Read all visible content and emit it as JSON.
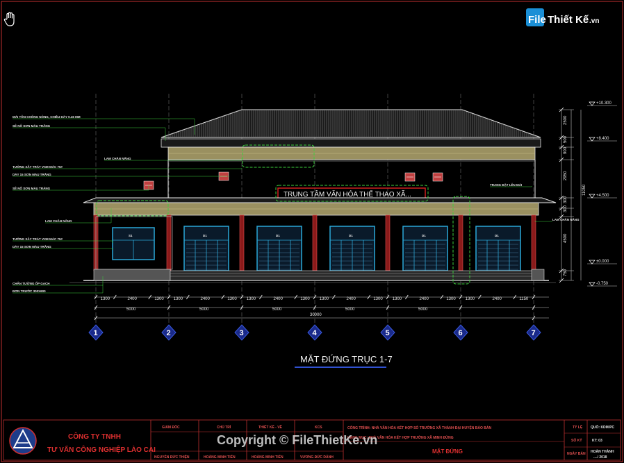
{
  "logo": {
    "part1": "File",
    "part2": "Thiết Kế",
    "suffix": ".vn"
  },
  "watermark": "Copyright © FileThietKe.vn",
  "sign_text": "TRUNG TÂM VĂN HÓA THỂ THAO XÃ...",
  "drawing_title": "MẶT ĐỨNG TRỤC 1-7",
  "annotations": [
    "MÁI TÔN CHỐNG NÓNG, CHIỀU DÀY 0.45 MM",
    "SÊ NÔ SƠN MÀU TRẮNG",
    "LAM CHẮN NẮNG",
    "TƯỜNG XÂY TRÁT VXM MÁC 75#",
    "DÀY 15 SƠN MÀU TRẮNG",
    "SÊ NÔ SƠN MÀU TRẮNG",
    "LAM CHẮN NẮNG",
    "TƯỜNG XÂY TRÁT VXM MÁC 75#",
    "DÀY 15 SƠN MÀU TRẮNG",
    "CHÂN TƯỜNG ỐP GẠCH",
    "ĐƠN TRƯỚC 300X600",
    "TRANG ĐẶT LÊN MÁI",
    "LAM CHẮN NẮNG"
  ],
  "window_labels": {
    "small": "S1",
    "door": "D1"
  },
  "levels": [
    "+10.300",
    "+8.400",
    "+4.500",
    "±0.000",
    "-0.750"
  ],
  "vertical_dims": [
    "2500",
    "500",
    "900",
    "2950",
    "300",
    "300",
    "4500",
    "750",
    "11050"
  ],
  "dims_row1": [
    "1300",
    "2400",
    "1300",
    "1300",
    "2400",
    "1300",
    "1300",
    "2400",
    "1300",
    "1300",
    "2400",
    "1300",
    "1300",
    "2400",
    "1300",
    "1300",
    "2400",
    "1150"
  ],
  "dims_row2": [
    "5000",
    "5000",
    "5000",
    "5000",
    "5000"
  ],
  "dim_total": "30000",
  "axes": [
    "1",
    "2",
    "3",
    "4",
    "5",
    "6",
    "7"
  ],
  "title_block": {
    "company_line1": "CÔNG TY TNHH",
    "company_line2": "TƯ VẤN CÔNG NGHIỆP LÀO CAI",
    "headers": [
      "GIÁM ĐỐC",
      "CHỦ TRÌ",
      "THIẾT KẾ - VẼ",
      "KCS"
    ],
    "names": [
      "NGUYỄN ĐỨC THIỆN",
      "HOÀNG MINH TIẾN",
      "HOÀNG MINH TIẾN",
      "VƯƠNG ĐỨC DÂNH"
    ],
    "project_line1": "CÔNG TRÌNH: NHÀ VĂN HÓA KẾT HỢP SỐ TRƯỜNG XÃ THÀNH ĐẠI HUYỆN BẢO BẢN",
    "project_line2": "HẠNG MỤC: NHÀ VĂN HÓA KẾT HỢP TRƯỜNG XÃ MINH ĐỨNG",
    "sheet_title": "MẶT ĐỨNG",
    "right_labels": [
      "TỶ LỆ",
      "SỐ KÝ",
      "NGÀY BẢN"
    ],
    "right_values": [
      "QUỐ: KDM/PC",
      "KT: 03",
      "HOÀN THÀNH",
      "..../ 2018"
    ]
  }
}
